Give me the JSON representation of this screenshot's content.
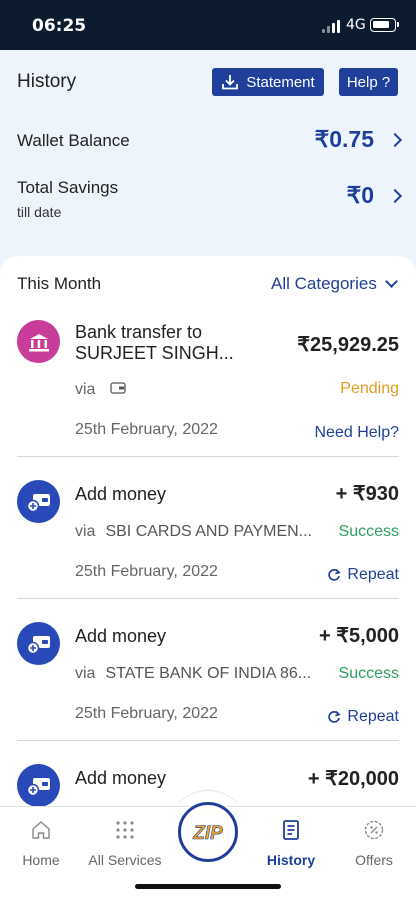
{
  "status_bar": {
    "time": "06:25",
    "network": "4G"
  },
  "header": {
    "title": "History",
    "statement_label": "Statement",
    "help_label": "Help ?"
  },
  "wallet": {
    "label": "Wallet Balance",
    "value": "₹0.75"
  },
  "savings": {
    "label": "Total Savings",
    "sublabel": "till date",
    "value": "₹0"
  },
  "list": {
    "title": "This Month",
    "filter_label": "All Categories"
  },
  "transactions": [
    {
      "title_line1": "Bank transfer to",
      "title_line2": "SURJEET  SINGH...",
      "amount": "₹25,929.25",
      "via": "via",
      "via_detail": "",
      "status": "Pending",
      "date": "25th February, 2022",
      "action": "Need Help?"
    },
    {
      "title": "Add money",
      "amount": "+ ₹930",
      "via": "via",
      "via_detail": "SBI CARDS AND PAYMEN...",
      "status": "Success",
      "date": "25th February, 2022",
      "action": "Repeat"
    },
    {
      "title": "Add money",
      "amount": "+ ₹5,000",
      "via": "via",
      "via_detail": "STATE BANK OF INDIA 86...",
      "status": "Success",
      "date": "25th February, 2022",
      "action": "Repeat"
    },
    {
      "title": "Add money",
      "amount": "+ ₹20,000"
    }
  ],
  "tabs": {
    "home": "Home",
    "services": "All Services",
    "center": "ZIP",
    "history": "History",
    "offers": "Offers"
  },
  "colors": {
    "brand": "#1f3f9a",
    "pending": "#e39a1e",
    "success": "#2f9e5f",
    "bank_icon_bg": "#c93d9a",
    "add_icon_bg": "#2a49b8"
  }
}
